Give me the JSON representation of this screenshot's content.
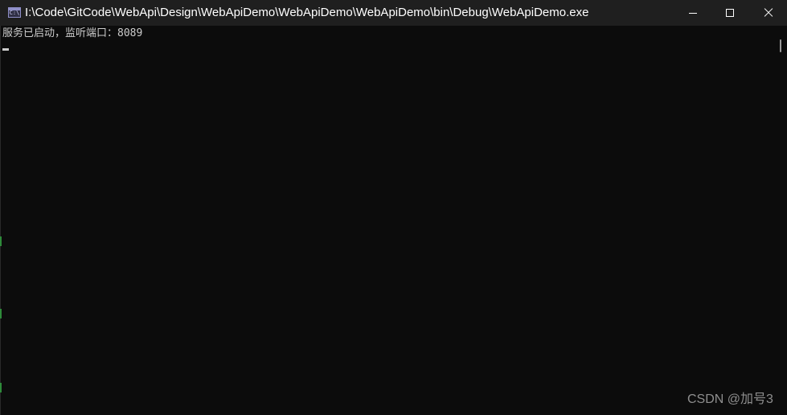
{
  "window": {
    "title": "I:\\Code\\GitCode\\WebApi\\Design\\WebApiDemo\\WebApiDemo\\WebApiDemo\\bin\\Debug\\WebApiDemo.exe",
    "icon": "console-app-icon",
    "icon_text": "C:\\"
  },
  "controls": {
    "minimize": "minimize-icon",
    "maximize": "maximize-icon",
    "close": "close-icon"
  },
  "console": {
    "lines": [
      "服务已启动，监听端口：8089"
    ],
    "background": "#0c0c0c",
    "foreground": "#cccccc"
  },
  "watermark": {
    "text": "CSDN @加号3"
  },
  "colors": {
    "titlebar": "#1f1f1f",
    "background_editor_text": "#3d9a4a"
  }
}
